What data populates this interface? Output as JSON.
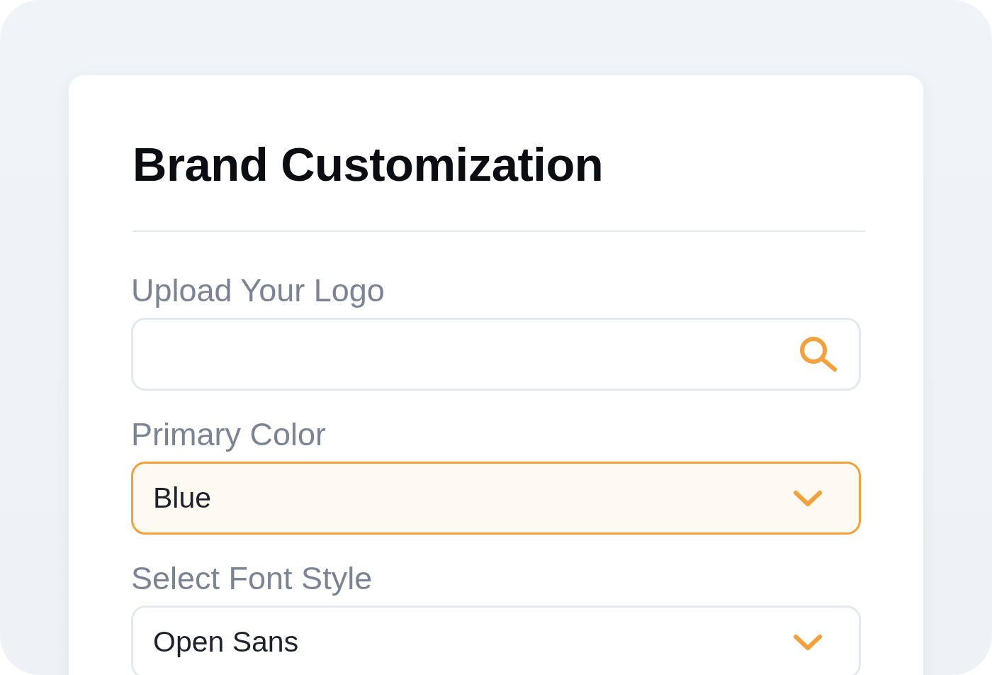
{
  "card": {
    "title": "Brand Customization",
    "fields": [
      {
        "kind": "search",
        "label": "Upload Your Logo",
        "focused": false
      },
      {
        "kind": "select",
        "label": "Primary Color",
        "value": "Blue",
        "focused": true
      },
      {
        "kind": "select",
        "label": "Select Font Style",
        "value": "Open Sans",
        "focused": false
      }
    ]
  }
}
